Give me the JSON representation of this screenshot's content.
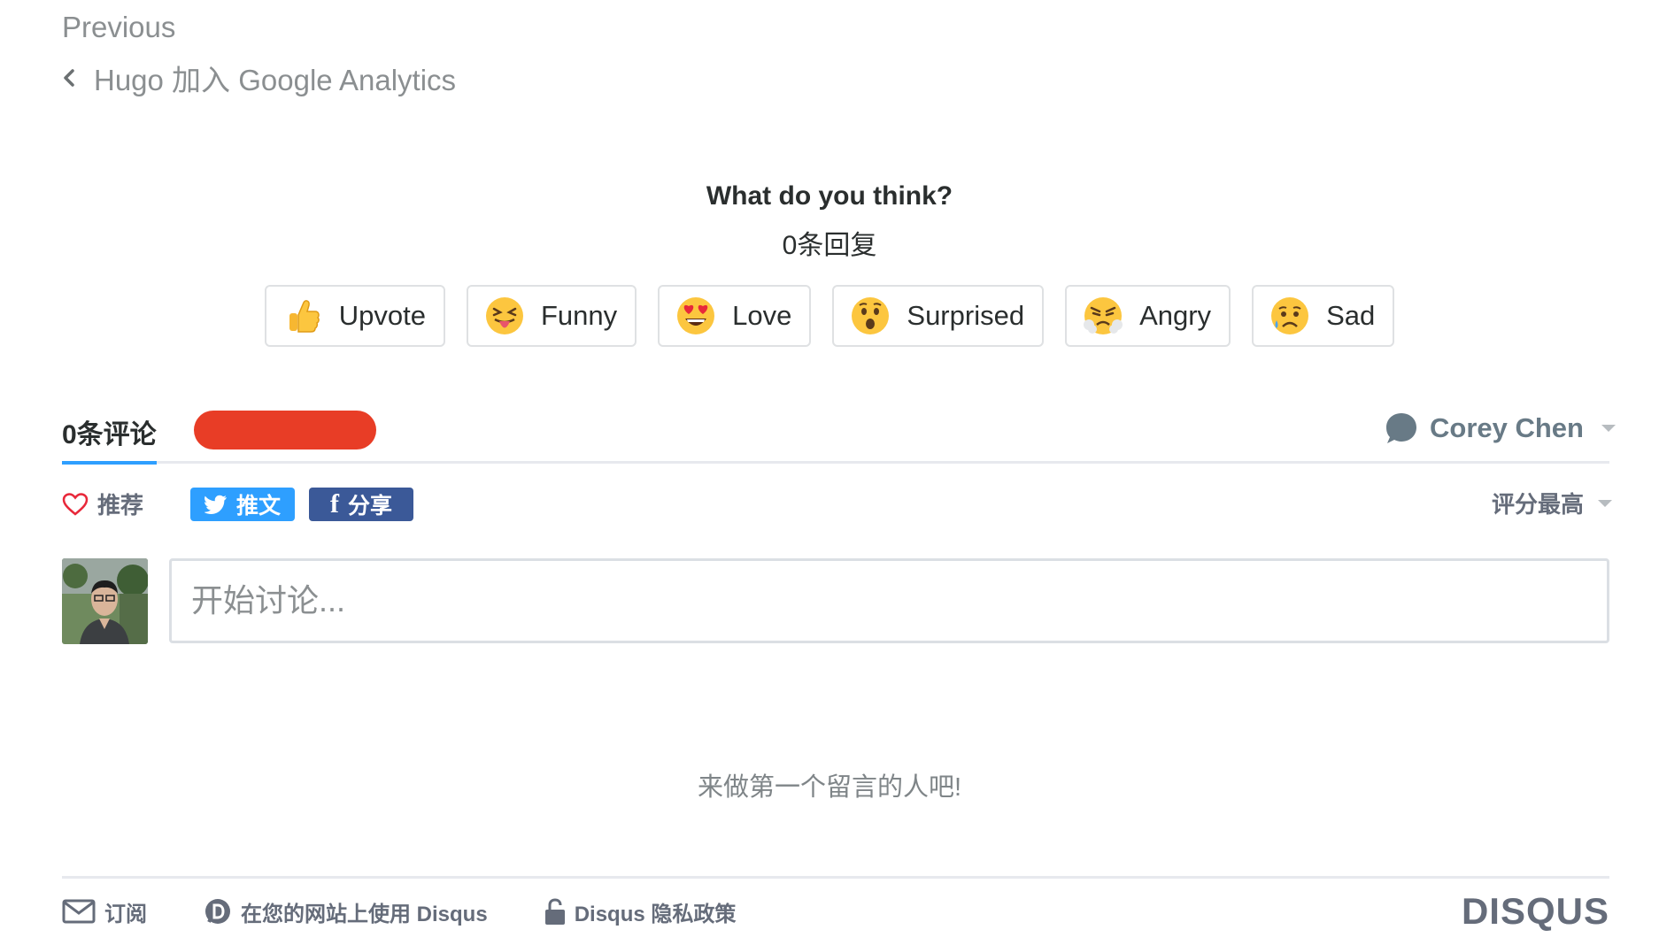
{
  "nav": {
    "previous_label": "Previous",
    "previous_post_title": "Hugo 加入 Google Analytics"
  },
  "reactions": {
    "title": "What do you think?",
    "count_text": "0条回复",
    "items": [
      {
        "label": "Upvote",
        "icon": "thumbs-up-icon"
      },
      {
        "label": "Funny",
        "icon": "tongue-out-emoji-icon"
      },
      {
        "label": "Love",
        "icon": "heart-eyes-emoji-icon"
      },
      {
        "label": "Surprised",
        "icon": "surprised-emoji-icon"
      },
      {
        "label": "Angry",
        "icon": "angry-emoji-icon"
      },
      {
        "label": "Sad",
        "icon": "sad-emoji-icon"
      }
    ]
  },
  "comments": {
    "tab_count": "0条评论",
    "user_name": "Corey Chen",
    "recommend_label": "推荐",
    "tweet_label": "推文",
    "share_label": "分享",
    "sort_label": "评分最高",
    "composer_placeholder": "开始讨论...",
    "empty_message": "来做第一个留言的人吧!"
  },
  "footer": {
    "subscribe_label": "订阅",
    "use_disqus_label": "在您的网站上使用 Disqus",
    "privacy_label": "Disqus 隐私政策",
    "logo_text": "DISQUS"
  },
  "colors": {
    "accent": "#2e9fff",
    "twitter": "#2e9fff",
    "facebook": "#3b5998",
    "redaction": "#e83d26",
    "muted_text": "#656c7a"
  }
}
